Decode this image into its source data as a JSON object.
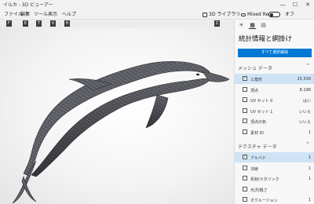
{
  "window": {
    "title": "イルカ - 3D ビューアー",
    "minimize_glyph": "—",
    "maximize_glyph": "☐",
    "close_glyph": "✕"
  },
  "menu": {
    "items": [
      "ファイル",
      "編集",
      "ツール",
      "表示",
      "ヘルプ"
    ],
    "library_label": "3D ライブラリ",
    "mixed_reality_label": "Mixed Reality",
    "toggle_label": "オフ"
  },
  "shortcuts": [
    "F",
    "E",
    "T",
    "V",
    "H"
  ],
  "shortcut_right": "Z",
  "panel": {
    "title": "統計情報と網掛け",
    "select_all_button": "すべて選択解除",
    "mesh_section": "メッシュ データ",
    "mesh_rows": [
      {
        "name": "三角形",
        "value": "15,530",
        "checked": true,
        "highlighted": true
      },
      {
        "name": "頂点",
        "value": "8,198",
        "checked": false,
        "highlighted": false
      },
      {
        "name": "UV セット 0",
        "value": "はい",
        "checked": false,
        "highlighted": false
      },
      {
        "name": "UV セット 1",
        "value": "いいえ",
        "checked": false,
        "highlighted": false
      },
      {
        "name": "頂点の色",
        "value": "いいえ",
        "checked": false,
        "highlighted": false
      },
      {
        "name": "素材 ID",
        "value": "1",
        "checked": false,
        "highlighted": false
      }
    ],
    "texture_section": "テクスチャ データ",
    "texture_rows": [
      {
        "name": "アルベド",
        "value": "1",
        "checked": true,
        "highlighted": true
      },
      {
        "name": "法線",
        "value": "1",
        "checked": false,
        "highlighted": false
      },
      {
        "name": "反射/メタリック",
        "value": "1",
        "checked": false,
        "highlighted": false
      },
      {
        "name": "光沢/粗さ",
        "value": "",
        "checked": false,
        "highlighted": false
      },
      {
        "name": "オクルージョン",
        "value": "1",
        "checked": false,
        "highlighted": false
      }
    ]
  },
  "colors": {
    "accent": "#0078d4",
    "highlight_row": "#cfe3f6",
    "model_fill": "#6e7077",
    "model_dark": "#2a2b2f"
  }
}
